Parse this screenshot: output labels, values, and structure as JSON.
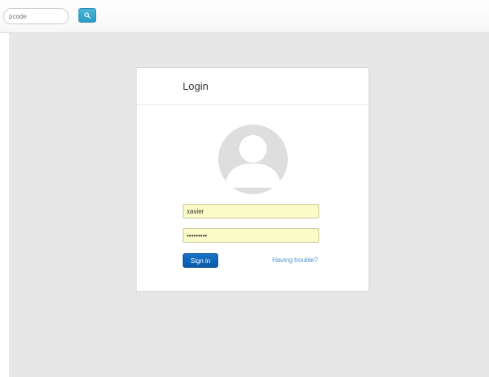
{
  "search": {
    "placeholder": "",
    "value": "pcode",
    "button_icon": "search-icon"
  },
  "login": {
    "title": "Login",
    "avatar_icon": "user-silhouette-icon",
    "username_value": "xavier",
    "password_value": "•••••••••",
    "signin_label": "Sign in",
    "trouble_label": "Having trouble?"
  },
  "colors": {
    "page_background": "#e7e7e7",
    "signin_button": "#0a5aa8",
    "search_button": "#2c9cc4",
    "autofill_field": "#fbfbc7",
    "link": "#4a90d6"
  }
}
